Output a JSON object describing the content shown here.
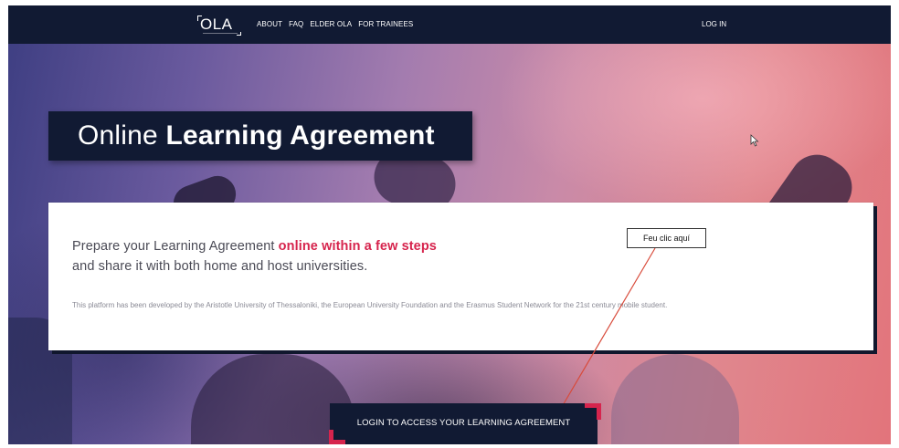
{
  "nav": {
    "logo_text": "OLA",
    "links": [
      "ABOUT",
      "FAQ",
      "ELDER OLA",
      "FOR TRAINEES"
    ],
    "login": "LOG IN"
  },
  "hero": {
    "title_light": "Online ",
    "title_bold": "Learning Agreement"
  },
  "card": {
    "lead_prefix": "Prepare your Learning Agreement ",
    "lead_highlight": "online within a few steps",
    "lead_line2": "and share it with both home and host universities.",
    "small_text": "This platform has been developed by the Aristotle University of Thessaloniki, the European University Foundation and the Erasmus Student Network for the 21st century mobile student."
  },
  "callout": {
    "text": "Feu clic aquí"
  },
  "cta": {
    "label": "LOGIN TO ACCESS YOUR LEARNING AGREEMENT"
  },
  "colors": {
    "navy": "#111a33",
    "accent": "#d6244d",
    "annotation_arrow": "#d84a3a"
  },
  "icons": [
    "mouse-cursor-icon"
  ]
}
